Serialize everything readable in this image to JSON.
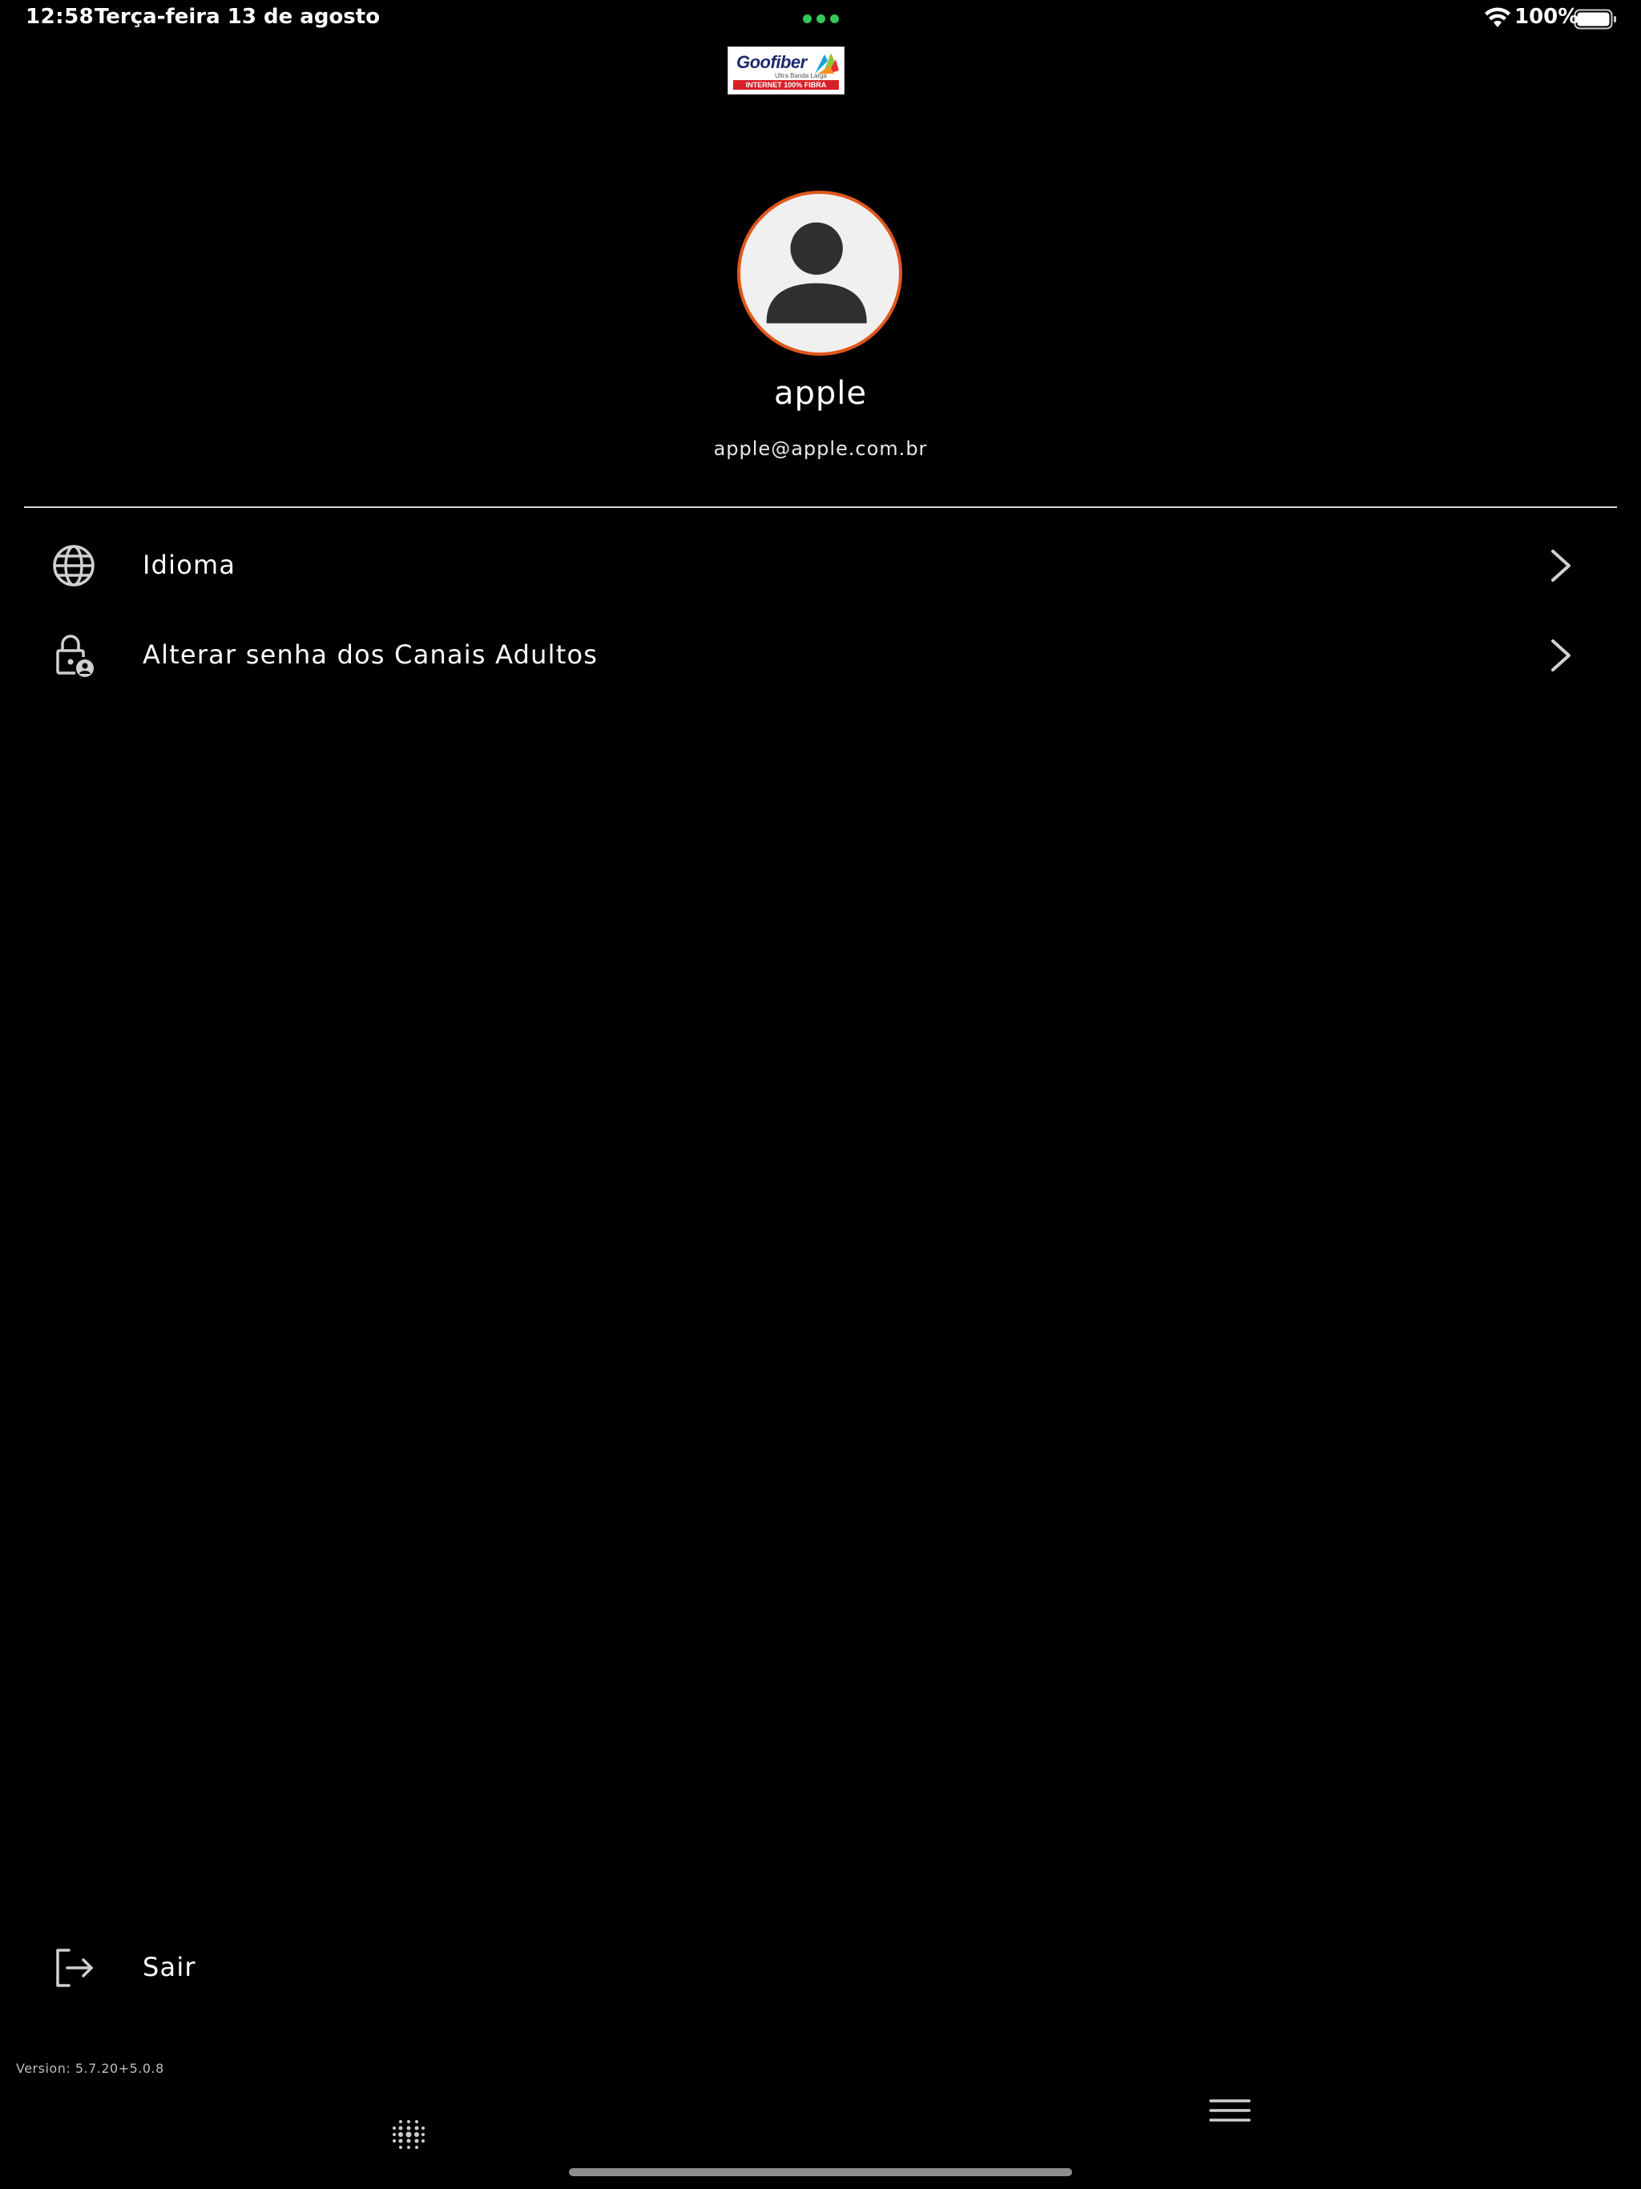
{
  "status_bar": {
    "time": "12:58",
    "date": "Terça-feira 13 de agosto",
    "battery": "100%",
    "dots_color": "#34c759"
  },
  "logo": {
    "name": "Goofiber",
    "tagline": "Ultra Banda Larga",
    "band": "INTERNET 100% FIBRA"
  },
  "profile": {
    "name": "apple",
    "email": "apple@apple.com.br",
    "avatar_border_color": "#e0561c"
  },
  "menu": {
    "items": [
      {
        "label": "Idioma",
        "icon": "globe-icon"
      },
      {
        "label": "Alterar senha dos Canais Adultos",
        "icon": "lock-user-icon"
      }
    ],
    "logout_label": "Sair"
  },
  "footer": {
    "version": "Version: 5.7.20+5.0.8"
  }
}
